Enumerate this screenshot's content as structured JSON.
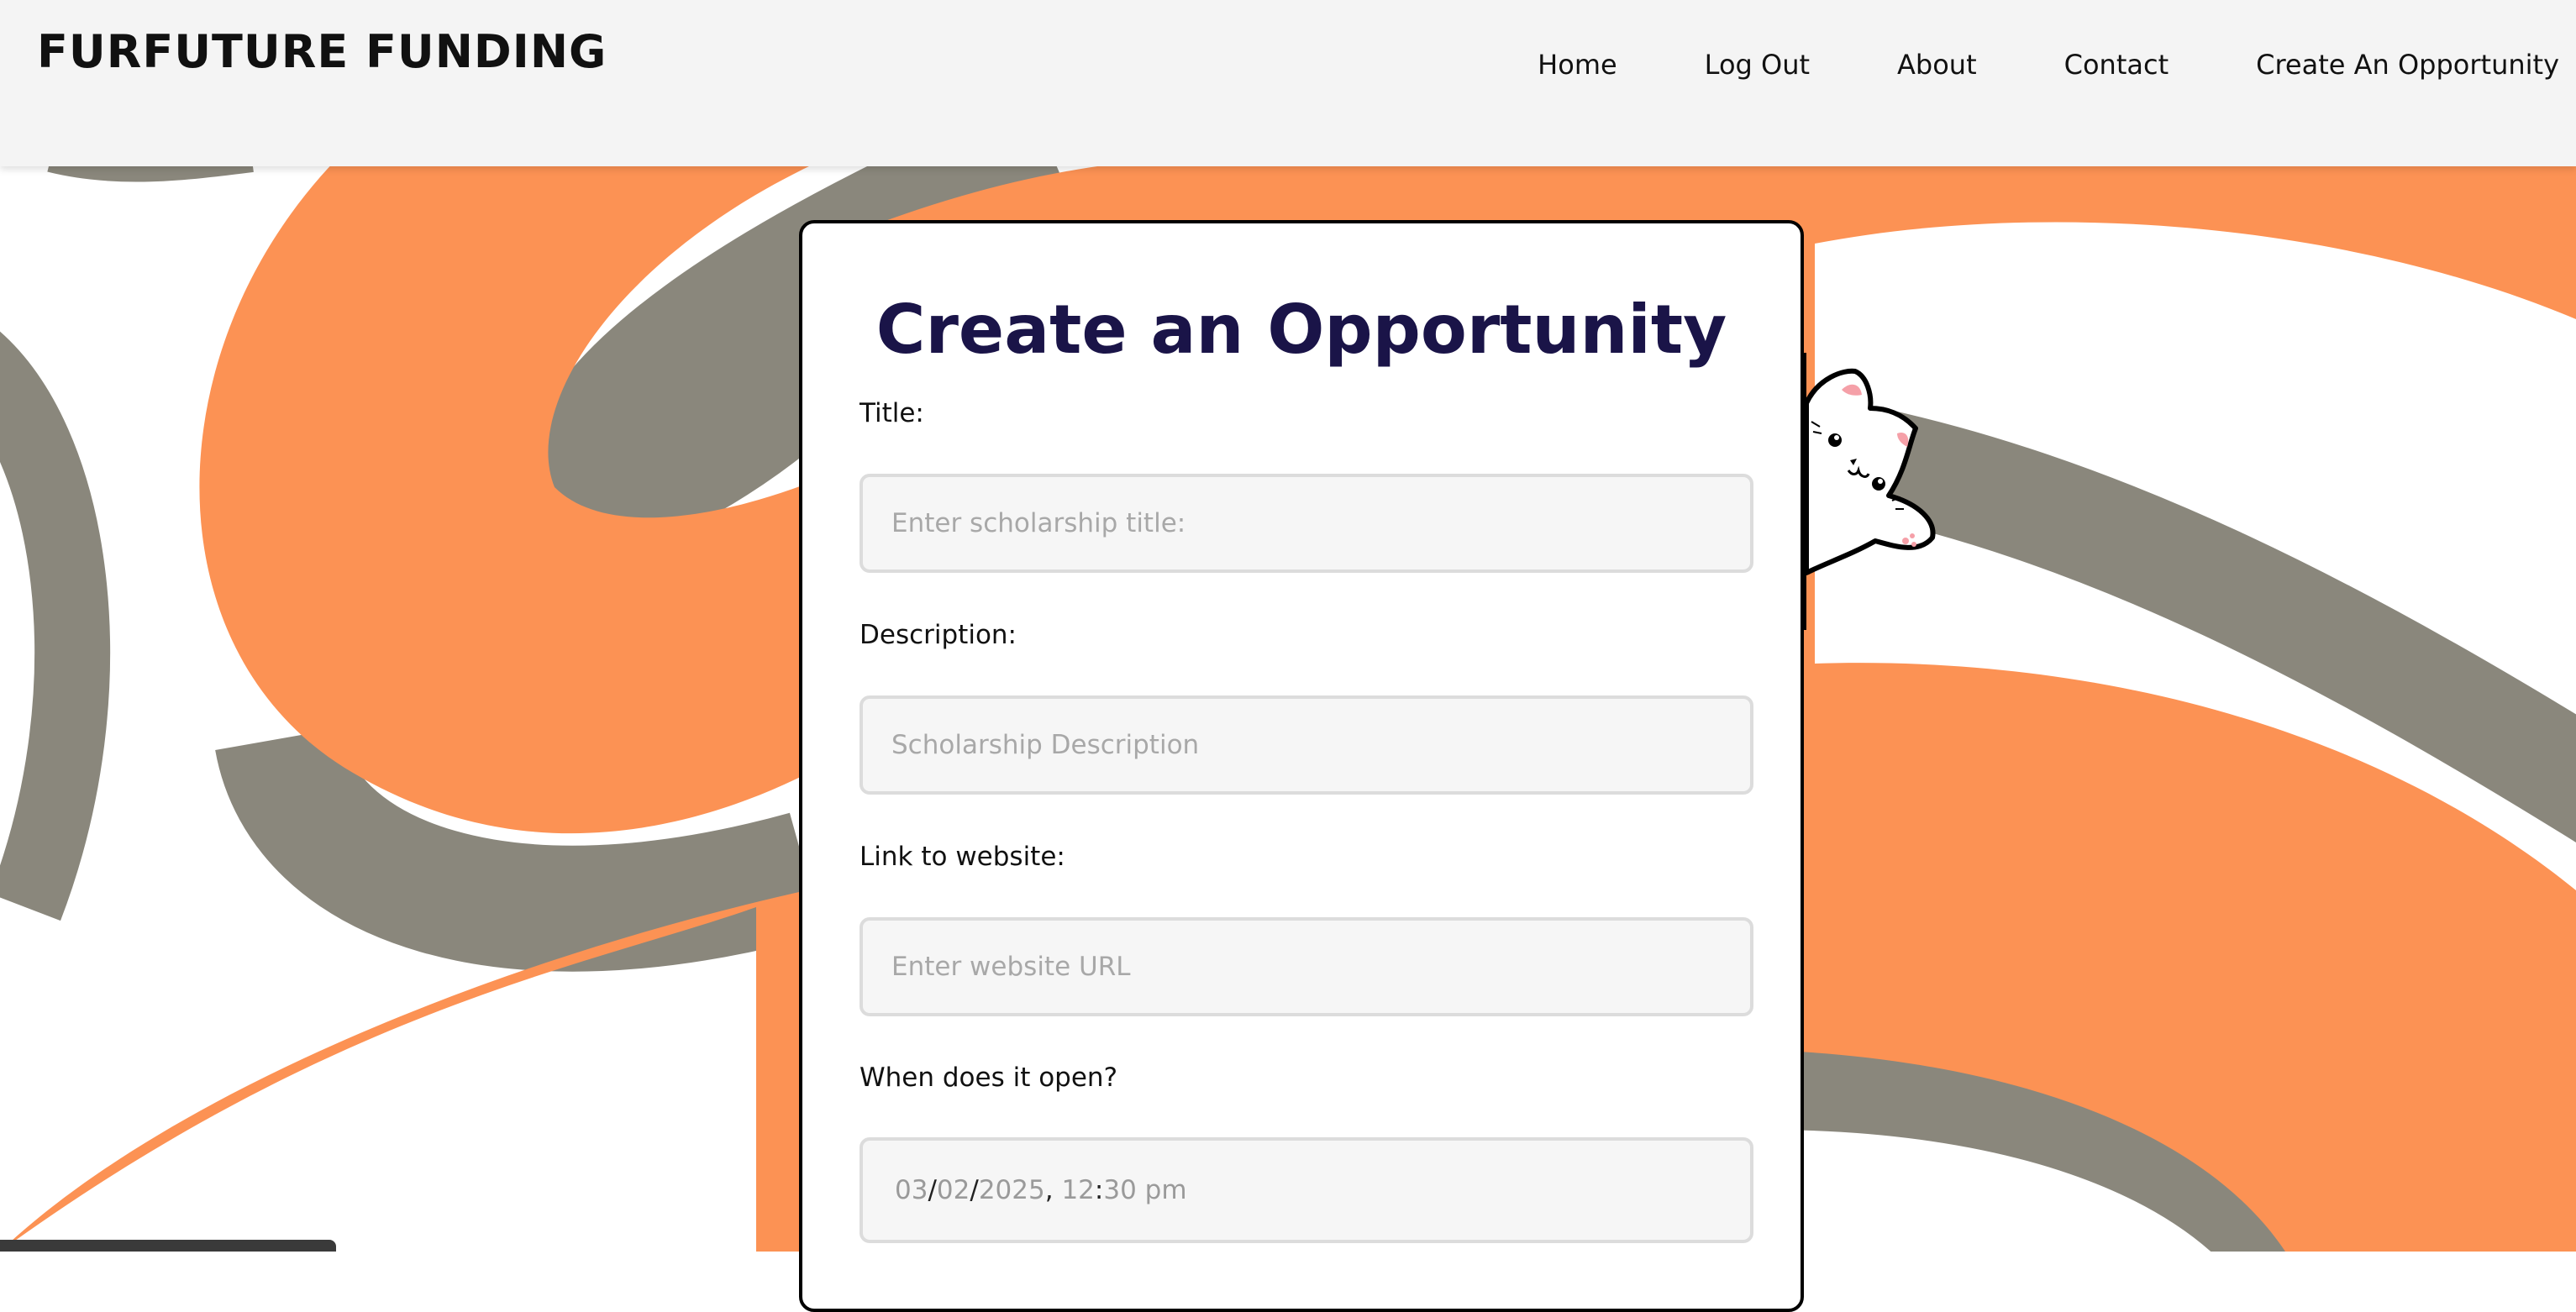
{
  "brand": {
    "name": "FURFUTURE FUNDING"
  },
  "nav": {
    "items": [
      {
        "label": "Home"
      },
      {
        "label": "Log Out"
      },
      {
        "label": "About"
      },
      {
        "label": "Contact"
      },
      {
        "label": "Create An Opportunity"
      }
    ]
  },
  "form": {
    "title": "Create an Opportunity",
    "fields": {
      "title": {
        "label": "Title:",
        "placeholder": "Enter scholarship title:"
      },
      "description": {
        "label": "Description:",
        "placeholder": "Scholarship Description"
      },
      "website": {
        "label": "Link to website:",
        "placeholder": "Enter website URL"
      },
      "open_date": {
        "label": "When does it open?",
        "month": "03",
        "day": "02",
        "year": "2025",
        "hour": "12",
        "minute": "30",
        "ampm": "pm"
      }
    }
  },
  "colors": {
    "accent_orange": "#fc9254",
    "accent_gray": "#8a877c",
    "title_navy": "#1a1448",
    "navbar_bg": "#f4f4f4"
  }
}
